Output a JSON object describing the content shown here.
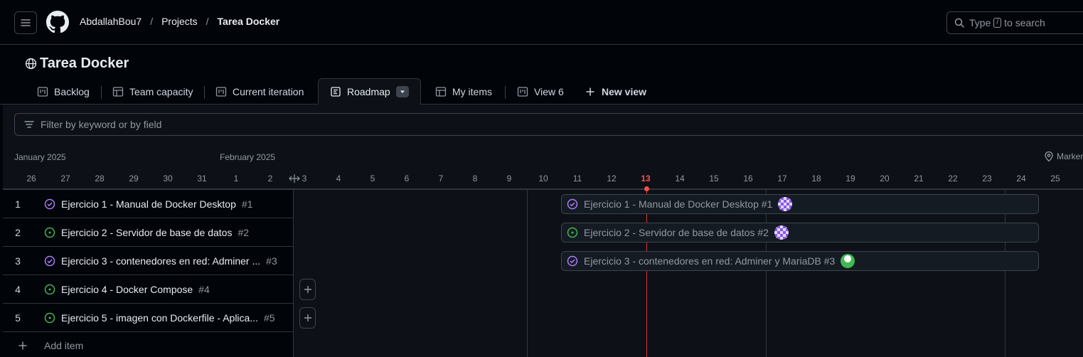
{
  "header": {
    "breadcrumb": [
      "AbdallahBou7",
      "Projects",
      "Tarea Docker"
    ],
    "search_prefix": "Type",
    "search_key": "/",
    "search_suffix": "to search"
  },
  "project": {
    "title": "Tarea Docker"
  },
  "tabs": [
    {
      "label": "Backlog",
      "icon": "board-icon"
    },
    {
      "label": "Team capacity",
      "icon": "table-icon"
    },
    {
      "label": "Current iteration",
      "icon": "board-icon"
    },
    {
      "label": "Roadmap",
      "icon": "roadmap-icon",
      "active": true
    },
    {
      "label": "My items",
      "icon": "table-icon"
    },
    {
      "label": "View 6",
      "icon": "board-icon"
    }
  ],
  "new_view_label": "New view",
  "filter": {
    "placeholder": "Filter by keyword or by field"
  },
  "timeline": {
    "months": [
      "January 2025",
      "February 2025"
    ],
    "markers_label": "Markers",
    "days": [
      "26",
      "27",
      "28",
      "29",
      "30",
      "31",
      "1",
      "2",
      "3",
      "4",
      "5",
      "6",
      "7",
      "8",
      "9",
      "10",
      "11",
      "12",
      "13",
      "14",
      "15",
      "16",
      "17",
      "18",
      "19",
      "20",
      "21",
      "22",
      "23",
      "24",
      "25"
    ],
    "today": "13"
  },
  "items": [
    {
      "num": "1",
      "title": "Ejercicio 1 - Manual de Docker Desktop",
      "ref": "#1",
      "status": "closed",
      "bar_label": "Ejercicio 1 - Manual de Docker Desktop #1"
    },
    {
      "num": "2",
      "title": "Ejercicio 2 - Servidor de base de datos",
      "ref": "#2",
      "status": "open",
      "bar_label": "Ejercicio 2 - Servidor de base de datos #2"
    },
    {
      "num": "3",
      "title": "Ejercicio 3 - contenedores en red: Adminer ...",
      "ref": "#3",
      "status": "closed",
      "bar_label": "Ejercicio 3 - contenedores en red: Adminer y MariaDB #3"
    },
    {
      "num": "4",
      "title": "Ejercicio 4 - Docker Compose",
      "ref": "#4",
      "status": "open"
    },
    {
      "num": "5",
      "title": "Ejercicio 5 - imagen con Dockerfile - Aplica...",
      "ref": "#5",
      "status": "open"
    }
  ],
  "add_item_label": "Add item",
  "colors": {
    "closed": "#ab7df8",
    "open": "#3fb950",
    "today": "#f85149"
  }
}
